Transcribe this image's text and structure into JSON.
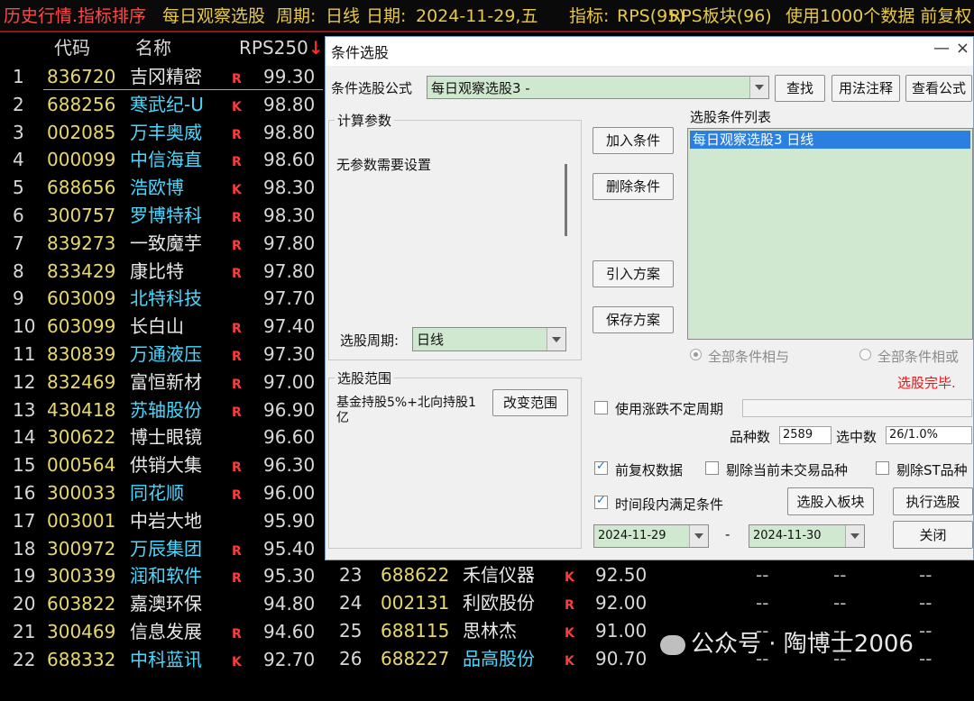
{
  "topbar": {
    "title": "历史行情.指标排序",
    "formula": "每日观察选股",
    "period_label": "周期:",
    "period": "日线",
    "date_label": "日期:",
    "date": "2024-11-29,五",
    "indicator_label": "指标:",
    "indicator": "RPS(95)",
    "block": "RPS板块(96)",
    "extra": "使用1000个数据 前复权"
  },
  "table_header": {
    "code": "代码",
    "name": "名称",
    "rps": "RPS250",
    "sort_icon": "arrow-down-icon"
  },
  "rows": [
    {
      "n": "1",
      "code": "836720",
      "name": "吉冈精密",
      "color": "w",
      "flag": "R",
      "val": "99.30"
    },
    {
      "n": "2",
      "code": "688256",
      "name": "寒武纪-U",
      "color": "c",
      "flag": "K",
      "val": "98.80"
    },
    {
      "n": "3",
      "code": "002085",
      "name": "万丰奥威",
      "color": "c",
      "flag": "R",
      "val": "98.80"
    },
    {
      "n": "4",
      "code": "000099",
      "name": "中信海直",
      "color": "c",
      "flag": "R",
      "val": "98.60"
    },
    {
      "n": "5",
      "code": "688656",
      "name": "浩欧博",
      "color": "c",
      "flag": "K",
      "val": "98.30"
    },
    {
      "n": "6",
      "code": "300757",
      "name": "罗博特科",
      "color": "c",
      "flag": "R",
      "val": "98.30"
    },
    {
      "n": "7",
      "code": "839273",
      "name": "一致魔芋",
      "color": "w",
      "flag": "R",
      "val": "97.80"
    },
    {
      "n": "8",
      "code": "833429",
      "name": "康比特",
      "color": "w",
      "flag": "R",
      "val": "97.80"
    },
    {
      "n": "9",
      "code": "603009",
      "name": "北特科技",
      "color": "c",
      "flag": "",
      "val": "97.70"
    },
    {
      "n": "10",
      "code": "603099",
      "name": "长白山",
      "color": "w",
      "flag": "R",
      "val": "97.40"
    },
    {
      "n": "11",
      "code": "830839",
      "name": "万通液压",
      "color": "c",
      "flag": "R",
      "val": "97.30"
    },
    {
      "n": "12",
      "code": "832469",
      "name": "富恒新材",
      "color": "w",
      "flag": "R",
      "val": "97.00"
    },
    {
      "n": "13",
      "code": "430418",
      "name": "苏轴股份",
      "color": "c",
      "flag": "R",
      "val": "96.90"
    },
    {
      "n": "14",
      "code": "300622",
      "name": "博士眼镜",
      "color": "w",
      "flag": "",
      "val": "96.60"
    },
    {
      "n": "15",
      "code": "000564",
      "name": "供销大集",
      "color": "w",
      "flag": "R",
      "val": "96.30"
    },
    {
      "n": "16",
      "code": "300033",
      "name": "同花顺",
      "color": "c",
      "flag": "R",
      "val": "96.00"
    },
    {
      "n": "17",
      "code": "003001",
      "name": "中岩大地",
      "color": "w",
      "flag": "",
      "val": "95.90"
    },
    {
      "n": "18",
      "code": "300972",
      "name": "万辰集团",
      "color": "c",
      "flag": "R",
      "val": "95.40"
    },
    {
      "n": "19",
      "code": "300339",
      "name": "润和软件",
      "color": "c",
      "flag": "R",
      "val": "95.30"
    },
    {
      "n": "20",
      "code": "603822",
      "name": "嘉澳环保",
      "color": "w",
      "flag": "",
      "val": "94.80"
    },
    {
      "n": "21",
      "code": "300469",
      "name": "信息发展",
      "color": "w",
      "flag": "R",
      "val": "94.60"
    },
    {
      "n": "22",
      "code": "688332",
      "name": "中科蓝讯",
      "color": "c",
      "flag": "K",
      "val": "92.70"
    }
  ],
  "rows_right": [
    {
      "n": "23",
      "code": "688622",
      "name": "禾信仪器",
      "color": "w",
      "flag": "K",
      "val": "92.50"
    },
    {
      "n": "24",
      "code": "002131",
      "name": "利欧股份",
      "color": "w",
      "flag": "R",
      "val": "92.00"
    },
    {
      "n": "25",
      "code": "688115",
      "name": "思林杰",
      "color": "w",
      "flag": "K",
      "val": "91.00"
    },
    {
      "n": "26",
      "code": "688227",
      "name": "品高股份",
      "color": "c",
      "flag": "K",
      "val": "90.70"
    }
  ],
  "dash": "--",
  "watermark": "公众号 · 陶博士2006",
  "dialog": {
    "title": "条件选股",
    "minimize": "—",
    "close": "×",
    "formula_label": "条件选股公式",
    "formula_value": "每日观察选股3  -",
    "btn_find": "查找",
    "btn_usage": "用法注释",
    "btn_view": "查看公式",
    "params_title": "计算参数",
    "params_text": "无参数需要设置",
    "period_label": "选股周期:",
    "period_value": "日线",
    "range_title": "选股范围",
    "range_text_1": "基金持股5%+北向持股1",
    "range_text_2": "亿",
    "btn_change_range": "改变范围",
    "btn_add": "加入条件",
    "btn_delete": "删除条件",
    "btn_import": "引入方案",
    "btn_save": "保存方案",
    "list_title": "选股条件列表",
    "list_item": "每日观察选股3  日线",
    "radio_and": "全部条件相与",
    "radio_or": "全部条件相或",
    "status": "选股完毕.",
    "use_var_period": "使用涨跌不定周期",
    "count_label": "品种数",
    "count_value": "2589",
    "selected_label": "选中数",
    "selected_value": "26/1.0%",
    "chk_adjust": "前复权数据",
    "chk_remove_untraded": "剔除当前未交易品种",
    "chk_remove_st": "剔除ST品种",
    "chk_period": "时间段内满足条件",
    "btn_to_block": "选股入板块",
    "btn_execute": "执行选股",
    "date_from": "2024-11-29",
    "date_sep": "-",
    "date_to": "2024-11-30",
    "btn_close": "关闭"
  }
}
